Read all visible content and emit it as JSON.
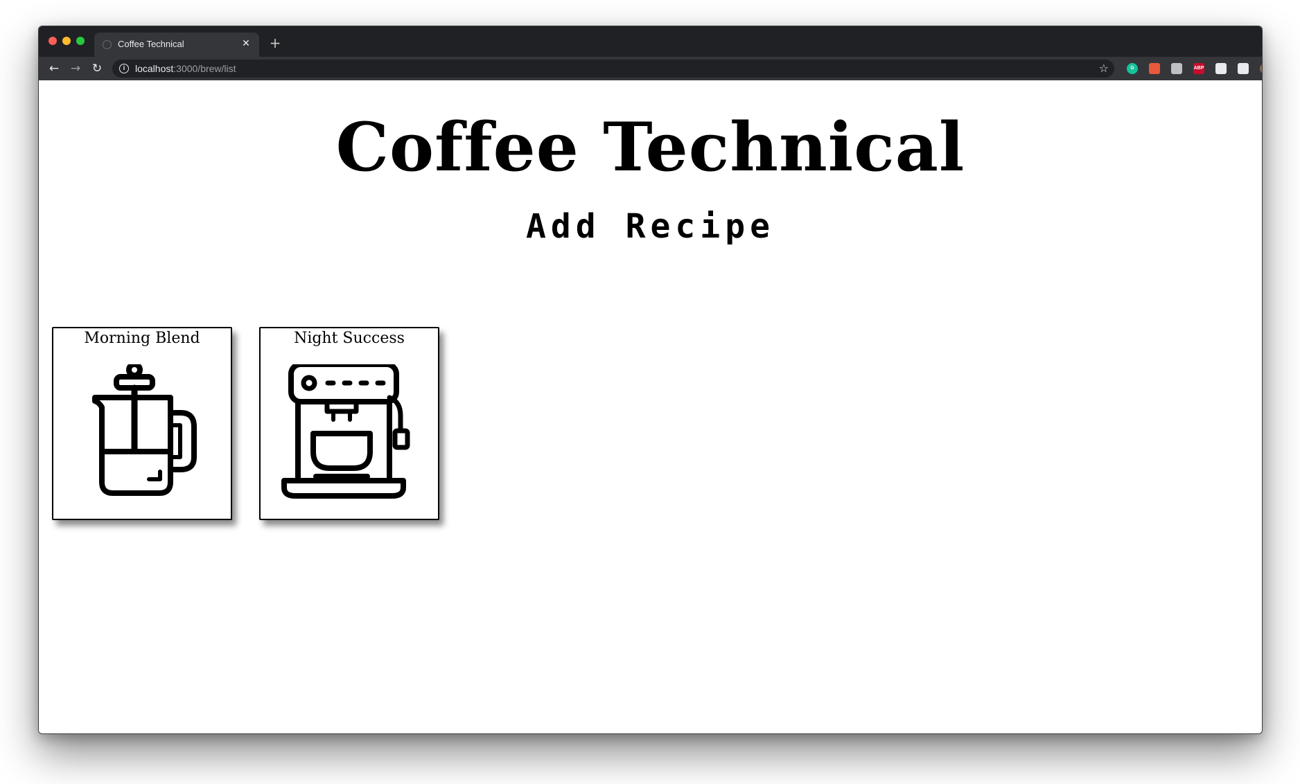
{
  "browser": {
    "tab_title": "Coffee Technical",
    "tab_close": "✕",
    "new_tab": "+",
    "nav": {
      "back": "←",
      "forward": "→",
      "reload": "↻"
    },
    "url_host": "localhost",
    "url_path": ":3000/brew/list",
    "info_glyph": "i",
    "star_glyph": "☆",
    "extensions": [
      {
        "name": "grammarly-icon",
        "color": "#15c39a",
        "label": "G"
      },
      {
        "name": "extension-orange-icon",
        "color": "#e8593c",
        "label": ""
      },
      {
        "name": "extension-gray-icon",
        "color": "#bdc1c6",
        "label": ""
      },
      {
        "name": "adblock-plus-icon",
        "color": "#c70d2c",
        "label": "ABP"
      },
      {
        "name": "puzzle-extensions-icon",
        "color": "#e8eaed",
        "label": ""
      },
      {
        "name": "media-queue-icon",
        "color": "#e8eaed",
        "label": ""
      },
      {
        "name": "profile-avatar-icon",
        "color": "#8a6a4e",
        "label": ""
      },
      {
        "name": "update-badge-icon",
        "color": "#f6bf26",
        "label": ""
      }
    ]
  },
  "page": {
    "title": "Coffee Technical",
    "add_recipe": "Add Recipe",
    "recipes": [
      {
        "name": "Morning Blend",
        "icon": "french-press-icon"
      },
      {
        "name": "Night Success",
        "icon": "espresso-machine-icon"
      }
    ]
  }
}
